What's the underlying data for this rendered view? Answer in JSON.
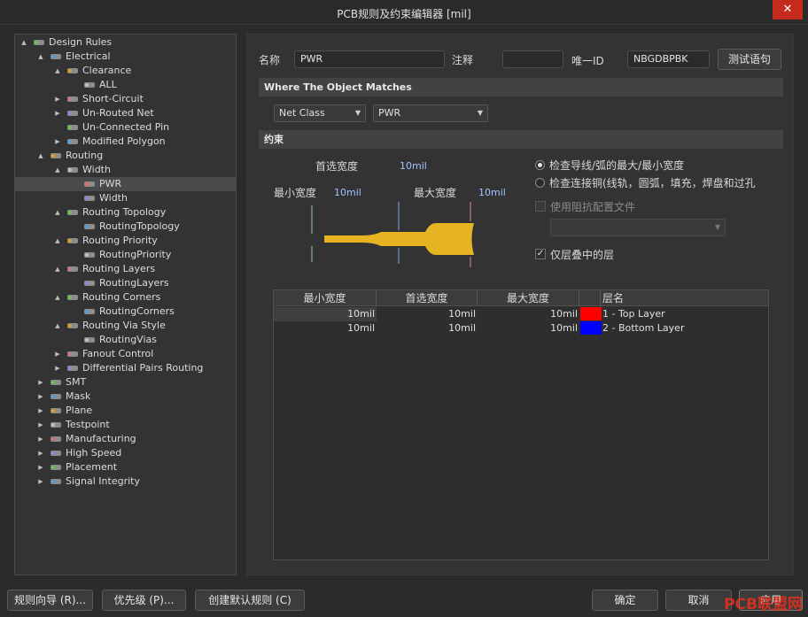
{
  "window": {
    "title": "PCB规则及约束编辑器 [mil]",
    "close_label": "✕"
  },
  "tree": [
    {
      "label": "Design Rules",
      "depth": 0,
      "arrow": "▲",
      "icon": "rules-root-icon"
    },
    {
      "label": "Electrical",
      "depth": 1,
      "arrow": "▲",
      "icon": "electrical-icon"
    },
    {
      "label": "Clearance",
      "depth": 2,
      "arrow": "▲",
      "icon": "clearance-icon"
    },
    {
      "label": "ALL",
      "depth": 3,
      "arrow": "",
      "icon": "rule-item-icon"
    },
    {
      "label": "Short-Circuit",
      "depth": 2,
      "arrow": "▶",
      "icon": "short-circuit-icon"
    },
    {
      "label": "Un-Routed Net",
      "depth": 2,
      "arrow": "▶",
      "icon": "unrouted-net-icon"
    },
    {
      "label": "Un-Connected Pin",
      "depth": 2,
      "arrow": "",
      "icon": "unconnected-pin-icon"
    },
    {
      "label": "Modified Polygon",
      "depth": 2,
      "arrow": "▶",
      "icon": "modified-polygon-icon"
    },
    {
      "label": "Routing",
      "depth": 1,
      "arrow": "▲",
      "icon": "routing-icon"
    },
    {
      "label": "Width",
      "depth": 2,
      "arrow": "▲",
      "icon": "width-icon"
    },
    {
      "label": "PWR",
      "depth": 3,
      "arrow": "",
      "icon": "rule-item-icon",
      "selected": true
    },
    {
      "label": "Width",
      "depth": 3,
      "arrow": "",
      "icon": "rule-item-icon"
    },
    {
      "label": "Routing Topology",
      "depth": 2,
      "arrow": "▲",
      "icon": "routing-topology-icon"
    },
    {
      "label": "RoutingTopology",
      "depth": 3,
      "arrow": "",
      "icon": "rule-item-icon"
    },
    {
      "label": "Routing Priority",
      "depth": 2,
      "arrow": "▲",
      "icon": "routing-priority-icon"
    },
    {
      "label": "RoutingPriority",
      "depth": 3,
      "arrow": "",
      "icon": "rule-item-icon"
    },
    {
      "label": "Routing Layers",
      "depth": 2,
      "arrow": "▲",
      "icon": "routing-layers-icon"
    },
    {
      "label": "RoutingLayers",
      "depth": 3,
      "arrow": "",
      "icon": "rule-item-icon"
    },
    {
      "label": "Routing Corners",
      "depth": 2,
      "arrow": "▲",
      "icon": "routing-corners-icon"
    },
    {
      "label": "RoutingCorners",
      "depth": 3,
      "arrow": "",
      "icon": "rule-item-icon"
    },
    {
      "label": "Routing Via Style",
      "depth": 2,
      "arrow": "▲",
      "icon": "routing-via-style-icon"
    },
    {
      "label": "RoutingVias",
      "depth": 3,
      "arrow": "",
      "icon": "rule-item-icon"
    },
    {
      "label": "Fanout Control",
      "depth": 2,
      "arrow": "▶",
      "icon": "fanout-control-icon"
    },
    {
      "label": "Differential Pairs Routing",
      "depth": 2,
      "arrow": "▶",
      "icon": "diff-pairs-icon"
    },
    {
      "label": "SMT",
      "depth": 1,
      "arrow": "▶",
      "icon": "smt-icon"
    },
    {
      "label": "Mask",
      "depth": 1,
      "arrow": "▶",
      "icon": "mask-icon"
    },
    {
      "label": "Plane",
      "depth": 1,
      "arrow": "▶",
      "icon": "plane-icon"
    },
    {
      "label": "Testpoint",
      "depth": 1,
      "arrow": "▶",
      "icon": "testpoint-icon"
    },
    {
      "label": "Manufacturing",
      "depth": 1,
      "arrow": "▶",
      "icon": "manufacturing-icon"
    },
    {
      "label": "High Speed",
      "depth": 1,
      "arrow": "▶",
      "icon": "high-speed-icon"
    },
    {
      "label": "Placement",
      "depth": 1,
      "arrow": "▶",
      "icon": "placement-icon"
    },
    {
      "label": "Signal Integrity",
      "depth": 1,
      "arrow": "▶",
      "icon": "signal-integrity-icon"
    }
  ],
  "rule": {
    "name_label": "名称",
    "name_value": "PWR",
    "comment_label": "注释",
    "comment_value": "",
    "uid_label": "唯一ID",
    "uid_value": "NBGDBPBK",
    "test_button": "测试语句"
  },
  "match": {
    "section_title": "Where The Object Matches",
    "type_value": "Net Class",
    "class_value": "PWR"
  },
  "constraints": {
    "section_title": "约束",
    "preferred_label": "首选宽度",
    "preferred_value": "10mil",
    "min_label": "最小宽度",
    "min_value": "10mil",
    "max_label": "最大宽度",
    "max_value": "10mil",
    "radio_1": "检查导线/弧的最大/最小宽度",
    "radio_2": "检查连接铜(线轨，圆弧，填充，焊盘和过孔",
    "impedance_label": "使用阻抗配置文件",
    "stack_only_label": "仅层叠中的层",
    "trace_color": "#e6b422"
  },
  "table": {
    "headers": [
      "最小宽度",
      "首选宽度",
      "最大宽度",
      "",
      "层名"
    ],
    "rows": [
      {
        "min": "10mil",
        "pref": "10mil",
        "max": "10mil",
        "color": "#ff0000",
        "layer": "1 - Top Layer"
      },
      {
        "min": "10mil",
        "pref": "10mil",
        "max": "10mil",
        "color": "#0000ff",
        "layer": "2 - Bottom Layer"
      }
    ]
  },
  "footer": {
    "wizard": "规则向导 (R)...",
    "priority": "优先级 (P)...",
    "create_default": "创建默认规则 (C)",
    "ok": "确定",
    "cancel": "取消",
    "apply": "应用"
  },
  "watermark": "PCB联盟网"
}
